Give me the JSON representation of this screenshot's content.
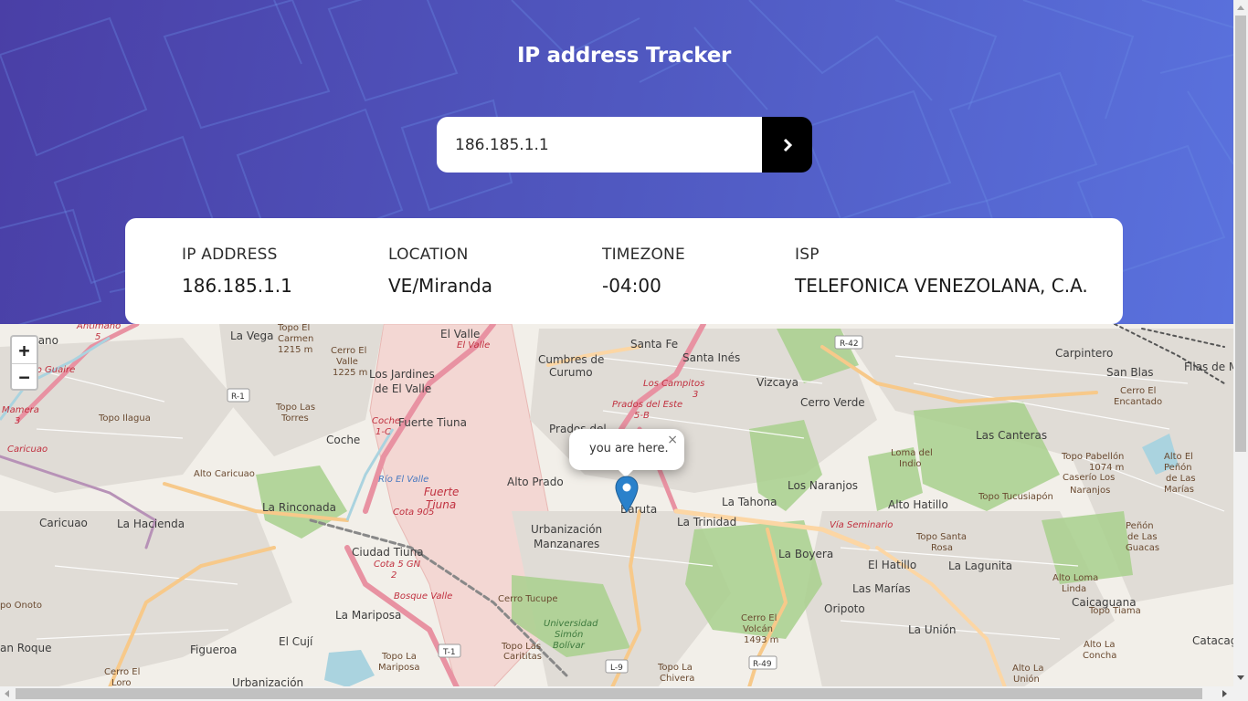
{
  "header": {
    "title": "IP address Tracker"
  },
  "search": {
    "value": "186.185.1.1",
    "button_icon": "chevron-right-icon"
  },
  "info": [
    {
      "label": "IP ADDRESS",
      "value": "186.185.1.1"
    },
    {
      "label": "LOCATION",
      "value": "VE/Miranda"
    },
    {
      "label": "TIMEZONE",
      "value": "-04:00"
    },
    {
      "label": "ISP",
      "value": "TELEFONICA VENEZOLANA, C.A."
    }
  ],
  "map": {
    "zoom_in": "+",
    "zoom_out": "−",
    "popup_text": "you are here.",
    "popup_close": "×",
    "labels": [
      "mano",
      "La Vega",
      "El Valle",
      "Santa Fe",
      "Santa Inés",
      "Carpintero",
      "San Blas",
      "Cumbres de",
      "Curumo",
      "Los Jardines",
      "de El Valle",
      "Vizcaya",
      "Cerro Verde",
      "Filas de M",
      "Fuerte Tiuna",
      "Coche",
      "Prados del",
      "Las Canteras",
      "Alto Prado",
      "Los Naranjos",
      "Alto Hatillo",
      "La Rinconada",
      "Caricuao",
      "La Hacienda",
      "Baruta",
      "La Tahona",
      "La Trinidad",
      "Urbanización",
      "Manzanares",
      "Ciudad Tiuna",
      "La Boyera",
      "El Hatillo",
      "La Lagunita",
      "Las Marías",
      "La Mariposa",
      "Oripoto",
      "Caicaguana",
      "El Cují",
      "Figueroa",
      "La Unión",
      "Catacag",
      "an Roque",
      "Urbanización"
    ],
    "minor_labels": [
      "Topo El",
      "Carmen",
      "1215 m",
      "Cerro El",
      "Valle",
      "1225 m",
      "Topo Las",
      "Torres",
      "Topo Ilagua",
      "Alto Caricuao",
      "Cerro El",
      "Encantado",
      "Loma del",
      "Indio",
      "Topo Pabellón",
      "1074 m",
      "Caserío Los",
      "Naranjos",
      "Topo Tucusiapón",
      "Alto El",
      "Peñón",
      "de Las",
      "Marías",
      "Topo Santa",
      "Rosa",
      "Peñón",
      "de Las",
      "Guacas",
      "Alto Loma",
      "Linda",
      "Topo Tiama",
      "Cerro Tucupe",
      "Cerro El",
      "Volcán",
      "1493 m",
      "Topo Las",
      "Carititas",
      "Topo La",
      "Mariposa",
      "Topo La",
      "Chivera",
      "Alto La",
      "Concha",
      "Alto La",
      "Unión",
      "Cerro El",
      "Loro",
      "po Onoto"
    ],
    "red_labels": [
      "Antímano",
      "5",
      "Río Guaire",
      "Mamera",
      "3",
      "Caricuao",
      "El Valle",
      "Los Campitos",
      "3",
      "Prados del Este",
      "5-B",
      "Coche",
      "1-C",
      "Cota 905",
      "Cota 5 GN",
      "2",
      "Bosque Valle",
      "Vía Seminario"
    ],
    "blue_labels": [
      "Río El Valle"
    ],
    "area_labels": [
      "Fuerte",
      "Tiuna",
      "Universidad",
      "Simón",
      "Bolívar"
    ],
    "shields": [
      "R-42",
      "R-1",
      "T-1",
      "L-9",
      "R-49"
    ]
  }
}
